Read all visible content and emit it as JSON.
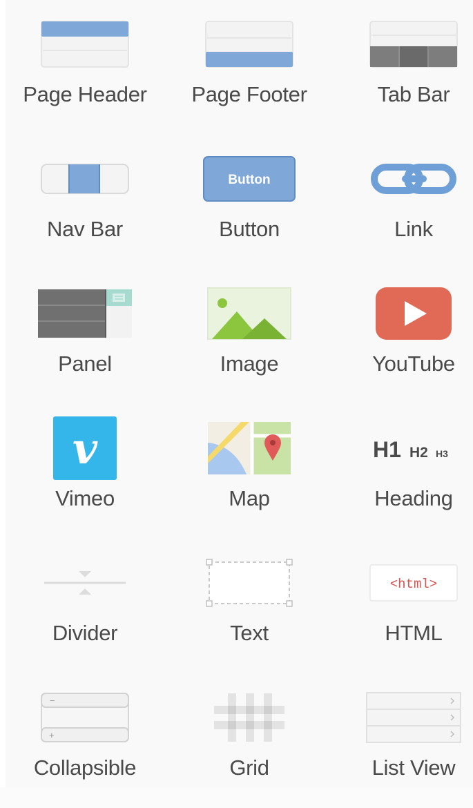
{
  "palette": {
    "widgets": [
      {
        "label": "Page Header",
        "icon": "page-header-icon"
      },
      {
        "label": "Page Footer",
        "icon": "page-footer-icon"
      },
      {
        "label": "Tab Bar",
        "icon": "tab-bar-icon"
      },
      {
        "label": "Nav Bar",
        "icon": "nav-bar-icon"
      },
      {
        "label": "Button",
        "icon": "button-icon",
        "icon_text": "Button"
      },
      {
        "label": "Link",
        "icon": "link-icon"
      },
      {
        "label": "Panel",
        "icon": "panel-icon"
      },
      {
        "label": "Image",
        "icon": "image-icon"
      },
      {
        "label": "YouTube",
        "icon": "youtube-icon"
      },
      {
        "label": "Vimeo",
        "icon": "vimeo-icon",
        "icon_text": "v"
      },
      {
        "label": "Map",
        "icon": "map-icon"
      },
      {
        "label": "Heading",
        "icon": "heading-icon",
        "icon_text": [
          "H1",
          "H2",
          "H3"
        ]
      },
      {
        "label": "Divider",
        "icon": "divider-icon"
      },
      {
        "label": "Text",
        "icon": "text-icon"
      },
      {
        "label": "HTML",
        "icon": "html-icon",
        "icon_text": "<html>"
      },
      {
        "label": "Collapsible",
        "icon": "collapsible-icon",
        "icon_text": [
          "−",
          "+"
        ]
      },
      {
        "label": "Grid",
        "icon": "grid-icon"
      },
      {
        "label": "List View",
        "icon": "list-view-icon"
      }
    ]
  },
  "colors": {
    "accent_blue": "#7fa8d8",
    "dark_gray": "#6d6d6d",
    "teal": "#a8dbcf",
    "image_green": "#8cc63f",
    "youtube_red": "#e06a55",
    "vimeo_blue": "#35b6eb",
    "map_red": "#e05a5a",
    "html_red": "#d9534f",
    "label_text": "#4a4a4a"
  }
}
